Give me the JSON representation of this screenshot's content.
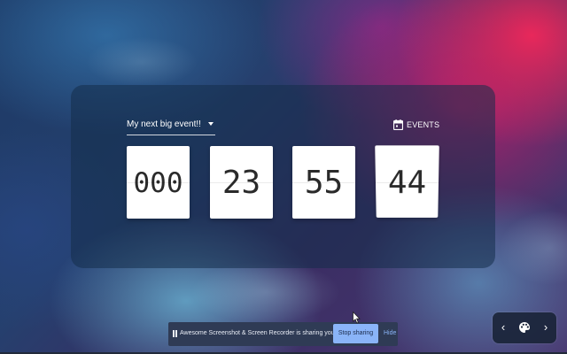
{
  "event_select": {
    "label": "My next big event!!"
  },
  "events_button": {
    "label": "EVENTS",
    "icon": "calendar-icon"
  },
  "countdown": {
    "days": "000",
    "hours": "23",
    "minutes": "55",
    "seconds": "44"
  },
  "share_bar": {
    "message": "Awesome Screenshot & Screen Recorder is sharing your screen.",
    "stop_label": "Stop sharing",
    "hide_label": "Hide"
  },
  "nav": {
    "prev_glyph": "‹",
    "next_glyph": "›",
    "palette_icon": "palette-icon"
  },
  "colors": {
    "panel": "#142d4b",
    "stop_button": "#8ab4f8",
    "share_bar": "#2f3b55"
  }
}
